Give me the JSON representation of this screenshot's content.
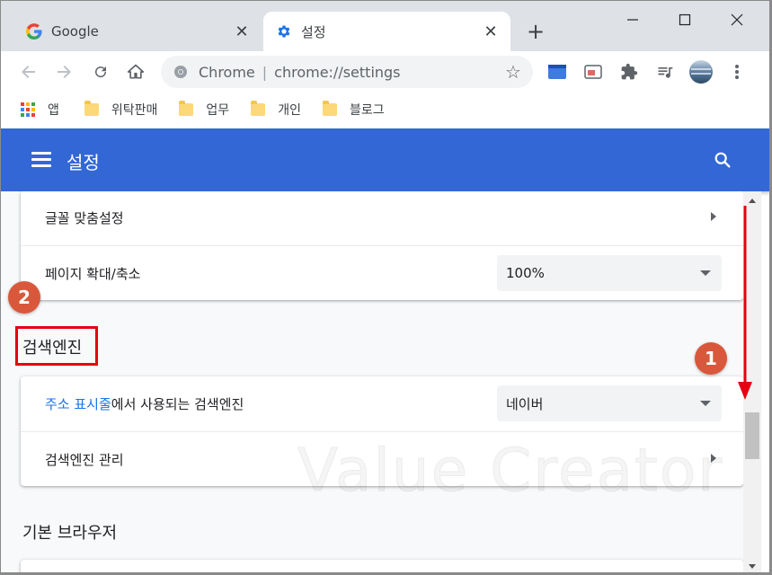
{
  "tabs": [
    {
      "title": "Google",
      "icon": "google-icon"
    },
    {
      "title": "설정",
      "icon": "gear-icon"
    }
  ],
  "new_tab_label": "+",
  "omnibox": {
    "scheme": "Chrome",
    "separator": "|",
    "url": "chrome://settings"
  },
  "bookmarks": [
    {
      "label": "앱",
      "icon": "apps-icon"
    },
    {
      "label": "위탁판매",
      "icon": "folder-icon"
    },
    {
      "label": "업무",
      "icon": "folder-icon"
    },
    {
      "label": "개인",
      "icon": "folder-icon"
    },
    {
      "label": "블로그",
      "icon": "folder-icon"
    }
  ],
  "header": {
    "title": "설정"
  },
  "appearance_card": {
    "font_settings_label": "글꼴 맞춤설정",
    "zoom_label": "페이지 확대/축소",
    "zoom_value": "100%"
  },
  "search_engine_section": {
    "title": "검색엔진",
    "address_bar_link": "주소 표시줄",
    "address_bar_rest": "에서 사용되는 검색엔진",
    "engine_value": "네이버",
    "manage_label": "검색엔진 관리"
  },
  "default_browser_section": {
    "title": "기본 브라우저"
  },
  "annotations": {
    "badge_1": "1",
    "badge_2": "2"
  },
  "watermark": "Value Creator",
  "colors": {
    "header_blue": "#3367d6",
    "badge": "#d9573b",
    "highlight_red": "#e60012",
    "link_blue": "#1a73e8"
  }
}
